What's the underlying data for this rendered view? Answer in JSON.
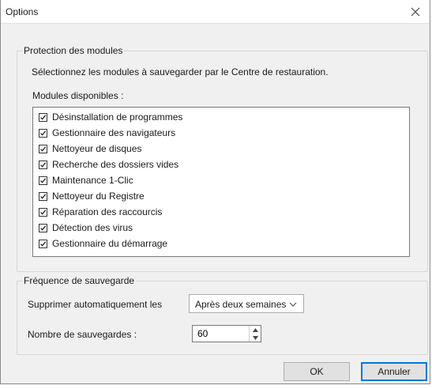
{
  "window": {
    "title": "Options",
    "close_icon": "close-icon"
  },
  "protection_group": {
    "legend": "Protection des modules",
    "instruction": "Sélectionnez les modules à sauvegarder par le Centre de restauration.",
    "list_label": "Modules disponibles :",
    "modules": [
      {
        "label": "Désinstallation de programmes",
        "checked": true
      },
      {
        "label": "Gestionnaire des navigateurs",
        "checked": true
      },
      {
        "label": "Nettoyeur de disques",
        "checked": true
      },
      {
        "label": "Recherche des dossiers vides",
        "checked": true
      },
      {
        "label": "Maintenance 1-Clic",
        "checked": true
      },
      {
        "label": "Nettoyeur du Registre",
        "checked": true
      },
      {
        "label": "Réparation des raccourcis",
        "checked": true
      },
      {
        "label": "Détection des virus",
        "checked": true
      },
      {
        "label": "Gestionnaire du démarrage",
        "checked": true
      }
    ]
  },
  "backup_group": {
    "legend": "Fréquence de sauvegarde",
    "delete_label": "Supprimer automatiquement les",
    "delete_value": "Après deux semaines",
    "count_label": "Nombre de sauvegardes :",
    "count_value": "60"
  },
  "buttons": {
    "ok": "OK",
    "cancel": "Annuler"
  }
}
